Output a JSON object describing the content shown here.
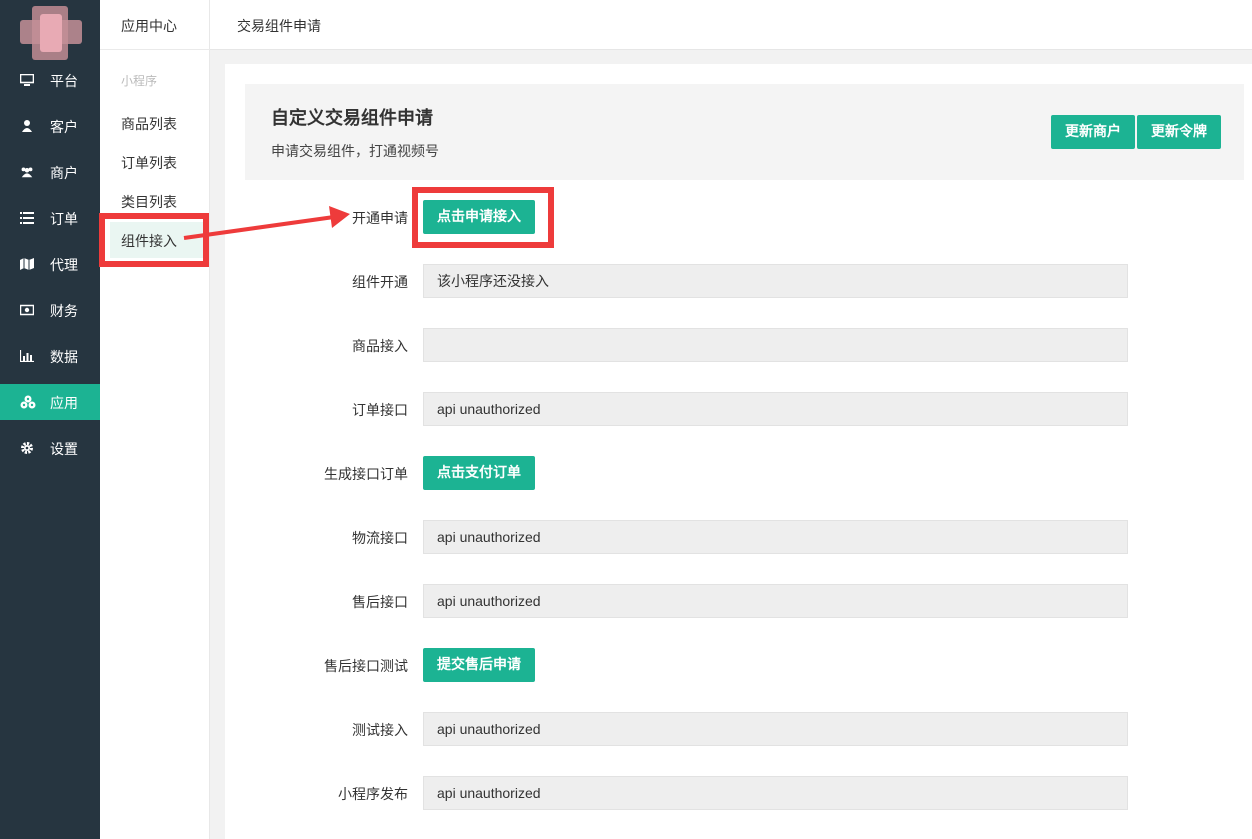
{
  "nav": {
    "items": [
      {
        "label": "平台",
        "icon": "monitor-icon"
      },
      {
        "label": "客户",
        "icon": "user-icon"
      },
      {
        "label": "商户",
        "icon": "users-icon"
      },
      {
        "label": "订单",
        "icon": "list-icon"
      },
      {
        "label": "代理",
        "icon": "map-icon"
      },
      {
        "label": "财务",
        "icon": "money-icon"
      },
      {
        "label": "数据",
        "icon": "bar-chart-icon"
      },
      {
        "label": "应用",
        "icon": "cubes-icon",
        "active": true
      },
      {
        "label": "设置",
        "icon": "gear-icon"
      }
    ]
  },
  "sidebar": {
    "header": "应用中心",
    "group": "小程序",
    "items": [
      {
        "label": "商品列表"
      },
      {
        "label": "订单列表"
      },
      {
        "label": "类目列表"
      },
      {
        "label": "组件接入",
        "active": true
      }
    ]
  },
  "header": {
    "breadcrumb": "交易组件申请"
  },
  "card": {
    "title": "自定义交易组件申请",
    "subtitle": "申请交易组件，打通视频号",
    "update_merchant": "更新商户",
    "update_token": "更新令牌"
  },
  "form": {
    "rows": [
      {
        "label": "开通申请",
        "button": "点击申请接入"
      },
      {
        "label": "组件开通",
        "value": "该小程序还没接入"
      },
      {
        "label": "商品接入",
        "value": ""
      },
      {
        "label": "订单接口",
        "value": "api unauthorized"
      },
      {
        "label": "生成接口订单",
        "button": "点击支付订单"
      },
      {
        "label": "物流接口",
        "value": "api unauthorized"
      },
      {
        "label": "售后接口",
        "value": "api unauthorized"
      },
      {
        "label": "售后接口测试",
        "button": "提交售后申请"
      },
      {
        "label": "测试接入",
        "value": "api unauthorized"
      },
      {
        "label": "小程序发布",
        "value": "api unauthorized"
      }
    ]
  },
  "colors": {
    "accent": "#1cb393",
    "nav_bg": "#263540",
    "annotation": "#ee3b3b"
  }
}
